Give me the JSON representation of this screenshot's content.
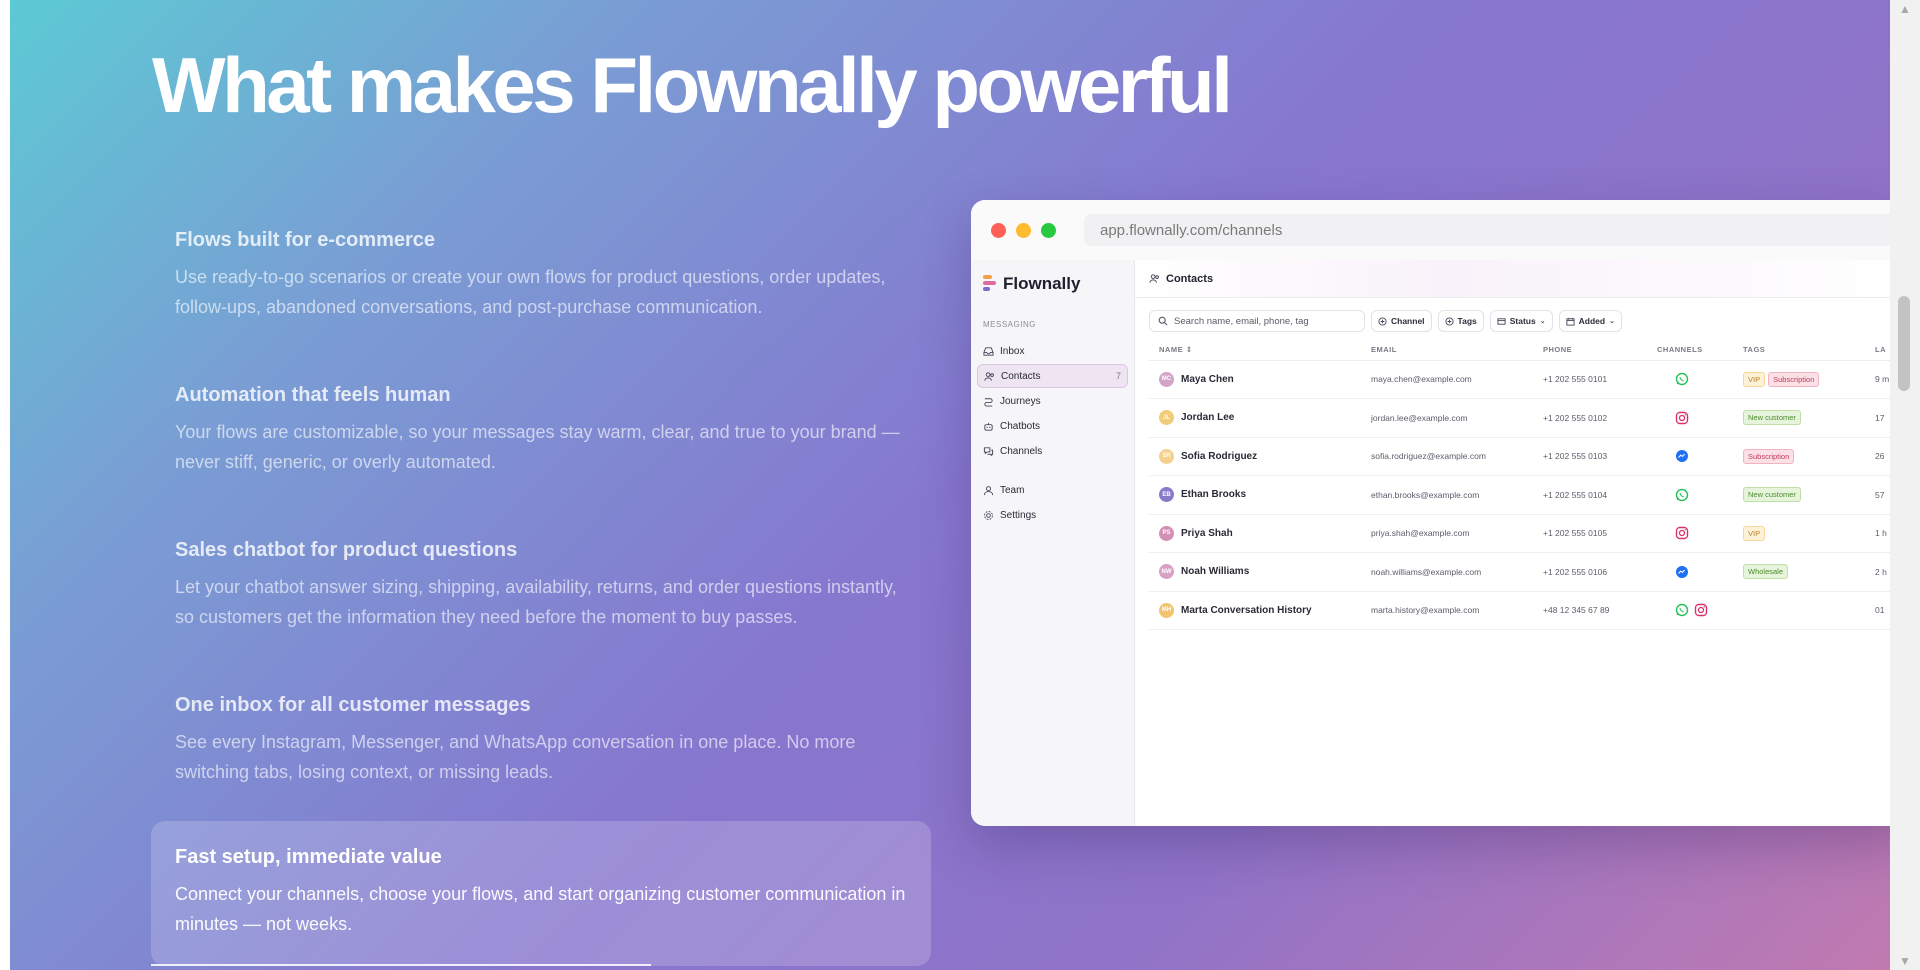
{
  "hero": {
    "title": "What makes Flownally powerful"
  },
  "features": [
    {
      "title": "Flows built for e-commerce",
      "text": "Use ready-to-go scenarios or create your own flows for product questions, order updates, follow-ups, abandoned conversations, and post-purchase communication."
    },
    {
      "title": "Automation that feels human",
      "text": "Your flows are customizable, so your messages stay warm, clear, and true to your brand — never stiff, generic, or overly automated."
    },
    {
      "title": "Sales chatbot for product questions",
      "text": "Let your chatbot answer sizing, shipping, availability, returns, and order questions instantly, so customers get the information they need before the moment to buy passes."
    },
    {
      "title": "One inbox for all customer messages",
      "text": "See every Instagram, Messenger, and WhatsApp conversation in one place. No more switching tabs, losing context, or missing leads."
    },
    {
      "title": "Fast setup, immediate value",
      "text": "Connect your channels, choose your flows, and start organizing customer communication in minutes — not weeks."
    }
  ],
  "active_feature_index": 4,
  "browser": {
    "url": "app.flownally.com/channels",
    "dots": [
      "#ff5f57",
      "#febc2e",
      "#28c840"
    ]
  },
  "app": {
    "brand": "Flownally",
    "nav_group": "MESSAGING",
    "nav": [
      {
        "label": "Inbox",
        "icon": "inbox-icon"
      },
      {
        "label": "Contacts",
        "icon": "contacts-icon",
        "count": "7",
        "active": true
      },
      {
        "label": "Journeys",
        "icon": "journeys-icon"
      },
      {
        "label": "Chatbots",
        "icon": "chatbot-icon"
      },
      {
        "label": "Channels",
        "icon": "channels-icon"
      }
    ],
    "nav_bottom": [
      {
        "label": "Team",
        "icon": "team-icon"
      },
      {
        "label": "Settings",
        "icon": "gear-icon"
      }
    ],
    "page_title": "Contacts",
    "search_placeholder": "Search name, email, phone, tag",
    "filters": [
      "Channel",
      "Tags",
      "Status",
      "Added"
    ],
    "columns": [
      "NAME",
      "EMAIL",
      "PHONE",
      "CHANNELS",
      "TAGS",
      "LA"
    ],
    "contacts": [
      {
        "initials": "MC",
        "avatar_color": "#d4a3c8",
        "name": "Maya Chen",
        "email": "maya.chen@example.com",
        "phone": "+1 202 555 0101",
        "channels": [
          "whatsapp"
        ],
        "tags": [
          {
            "label": "VIP",
            "kind": "vip"
          },
          {
            "label": "Subscription",
            "kind": "sub"
          }
        ],
        "last": "9 m"
      },
      {
        "initials": "JL",
        "avatar_color": "#f1cc7a",
        "name": "Jordan Lee",
        "email": "jordan.lee@example.com",
        "phone": "+1 202 555 0102",
        "channels": [
          "instagram"
        ],
        "tags": [
          {
            "label": "New customer",
            "kind": "new"
          }
        ],
        "last": "17"
      },
      {
        "initials": "SR",
        "avatar_color": "#f3d08e",
        "name": "Sofia Rodriguez",
        "email": "sofia.rodriguez@example.com",
        "phone": "+1 202 555 0103",
        "channels": [
          "messenger"
        ],
        "tags": [
          {
            "label": "Subscription",
            "kind": "sub"
          }
        ],
        "last": "26"
      },
      {
        "initials": "EB",
        "avatar_color": "#8a79c8",
        "name": "Ethan Brooks",
        "email": "ethan.brooks@example.com",
        "phone": "+1 202 555 0104",
        "channels": [
          "whatsapp"
        ],
        "tags": [
          {
            "label": "New customer",
            "kind": "new"
          }
        ],
        "last": "57"
      },
      {
        "initials": "PS",
        "avatar_color": "#d48fb6",
        "name": "Priya Shah",
        "email": "priya.shah@example.com",
        "phone": "+1 202 555 0105",
        "channels": [
          "instagram"
        ],
        "tags": [
          {
            "label": "VIP",
            "kind": "vip"
          }
        ],
        "last": "1 h"
      },
      {
        "initials": "NW",
        "avatar_color": "#d9a0c4",
        "name": "Noah Williams",
        "email": "noah.williams@example.com",
        "phone": "+1 202 555 0106",
        "channels": [
          "messenger"
        ],
        "tags": [
          {
            "label": "Wholesale",
            "kind": "whole"
          }
        ],
        "last": "2 h"
      },
      {
        "initials": "MH",
        "avatar_color": "#f2c46e",
        "name": "Marta Conversation History",
        "email": "marta.history@example.com",
        "phone": "+48 12 345 67 89",
        "channels": [
          "whatsapp",
          "instagram"
        ],
        "tags": [],
        "last": "01"
      }
    ]
  },
  "colors": {
    "whatsapp": "#25c05a",
    "instagram": "#d9306e",
    "messenger": "#1f6ff5"
  }
}
